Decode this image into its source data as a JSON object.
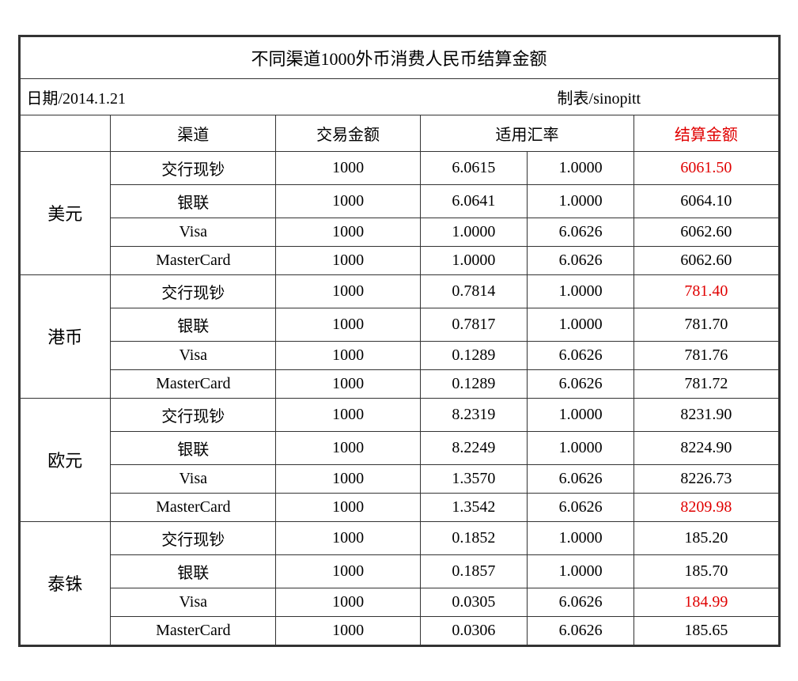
{
  "title": "不同渠道1000外币消费人民币结算金额",
  "subtitle": {
    "date_label": "日期/2014.1.21",
    "maker_label": "制表/sinopitt"
  },
  "headers": {
    "col1": "",
    "col2": "渠道",
    "col3": "交易金额",
    "col4": "适用汇率",
    "col5": "结算金额"
  },
  "currencies": [
    {
      "name": "美元",
      "rows": [
        {
          "channel": "交行现钞",
          "amount": "1000",
          "rate1": "6.0615",
          "rate2": "1.0000",
          "settlement": "6061.50",
          "red": true
        },
        {
          "channel": "银联",
          "amount": "1000",
          "rate1": "6.0641",
          "rate2": "1.0000",
          "settlement": "6064.10",
          "red": false
        },
        {
          "channel": "Visa",
          "amount": "1000",
          "rate1": "1.0000",
          "rate2": "6.0626",
          "settlement": "6062.60",
          "red": false
        },
        {
          "channel": "MasterCard",
          "amount": "1000",
          "rate1": "1.0000",
          "rate2": "6.0626",
          "settlement": "6062.60",
          "red": false
        }
      ]
    },
    {
      "name": "港币",
      "rows": [
        {
          "channel": "交行现钞",
          "amount": "1000",
          "rate1": "0.7814",
          "rate2": "1.0000",
          "settlement": "781.40",
          "red": true
        },
        {
          "channel": "银联",
          "amount": "1000",
          "rate1": "0.7817",
          "rate2": "1.0000",
          "settlement": "781.70",
          "red": false
        },
        {
          "channel": "Visa",
          "amount": "1000",
          "rate1": "0.1289",
          "rate2": "6.0626",
          "settlement": "781.76",
          "red": false
        },
        {
          "channel": "MasterCard",
          "amount": "1000",
          "rate1": "0.1289",
          "rate2": "6.0626",
          "settlement": "781.72",
          "red": false
        }
      ]
    },
    {
      "name": "欧元",
      "rows": [
        {
          "channel": "交行现钞",
          "amount": "1000",
          "rate1": "8.2319",
          "rate2": "1.0000",
          "settlement": "8231.90",
          "red": false
        },
        {
          "channel": "银联",
          "amount": "1000",
          "rate1": "8.2249",
          "rate2": "1.0000",
          "settlement": "8224.90",
          "red": false
        },
        {
          "channel": "Visa",
          "amount": "1000",
          "rate1": "1.3570",
          "rate2": "6.0626",
          "settlement": "8226.73",
          "red": false
        },
        {
          "channel": "MasterCard",
          "amount": "1000",
          "rate1": "1.3542",
          "rate2": "6.0626",
          "settlement": "8209.98",
          "red": true
        }
      ]
    },
    {
      "name": "泰铢",
      "rows": [
        {
          "channel": "交行现钞",
          "amount": "1000",
          "rate1": "0.1852",
          "rate2": "1.0000",
          "settlement": "185.20",
          "red": false
        },
        {
          "channel": "银联",
          "amount": "1000",
          "rate1": "0.1857",
          "rate2": "1.0000",
          "settlement": "185.70",
          "red": false
        },
        {
          "channel": "Visa",
          "amount": "1000",
          "rate1": "0.0305",
          "rate2": "6.0626",
          "settlement": "184.99",
          "red": true
        },
        {
          "channel": "MasterCard",
          "amount": "1000",
          "rate1": "0.0306",
          "rate2": "6.0626",
          "settlement": "185.65",
          "red": false
        }
      ]
    }
  ]
}
